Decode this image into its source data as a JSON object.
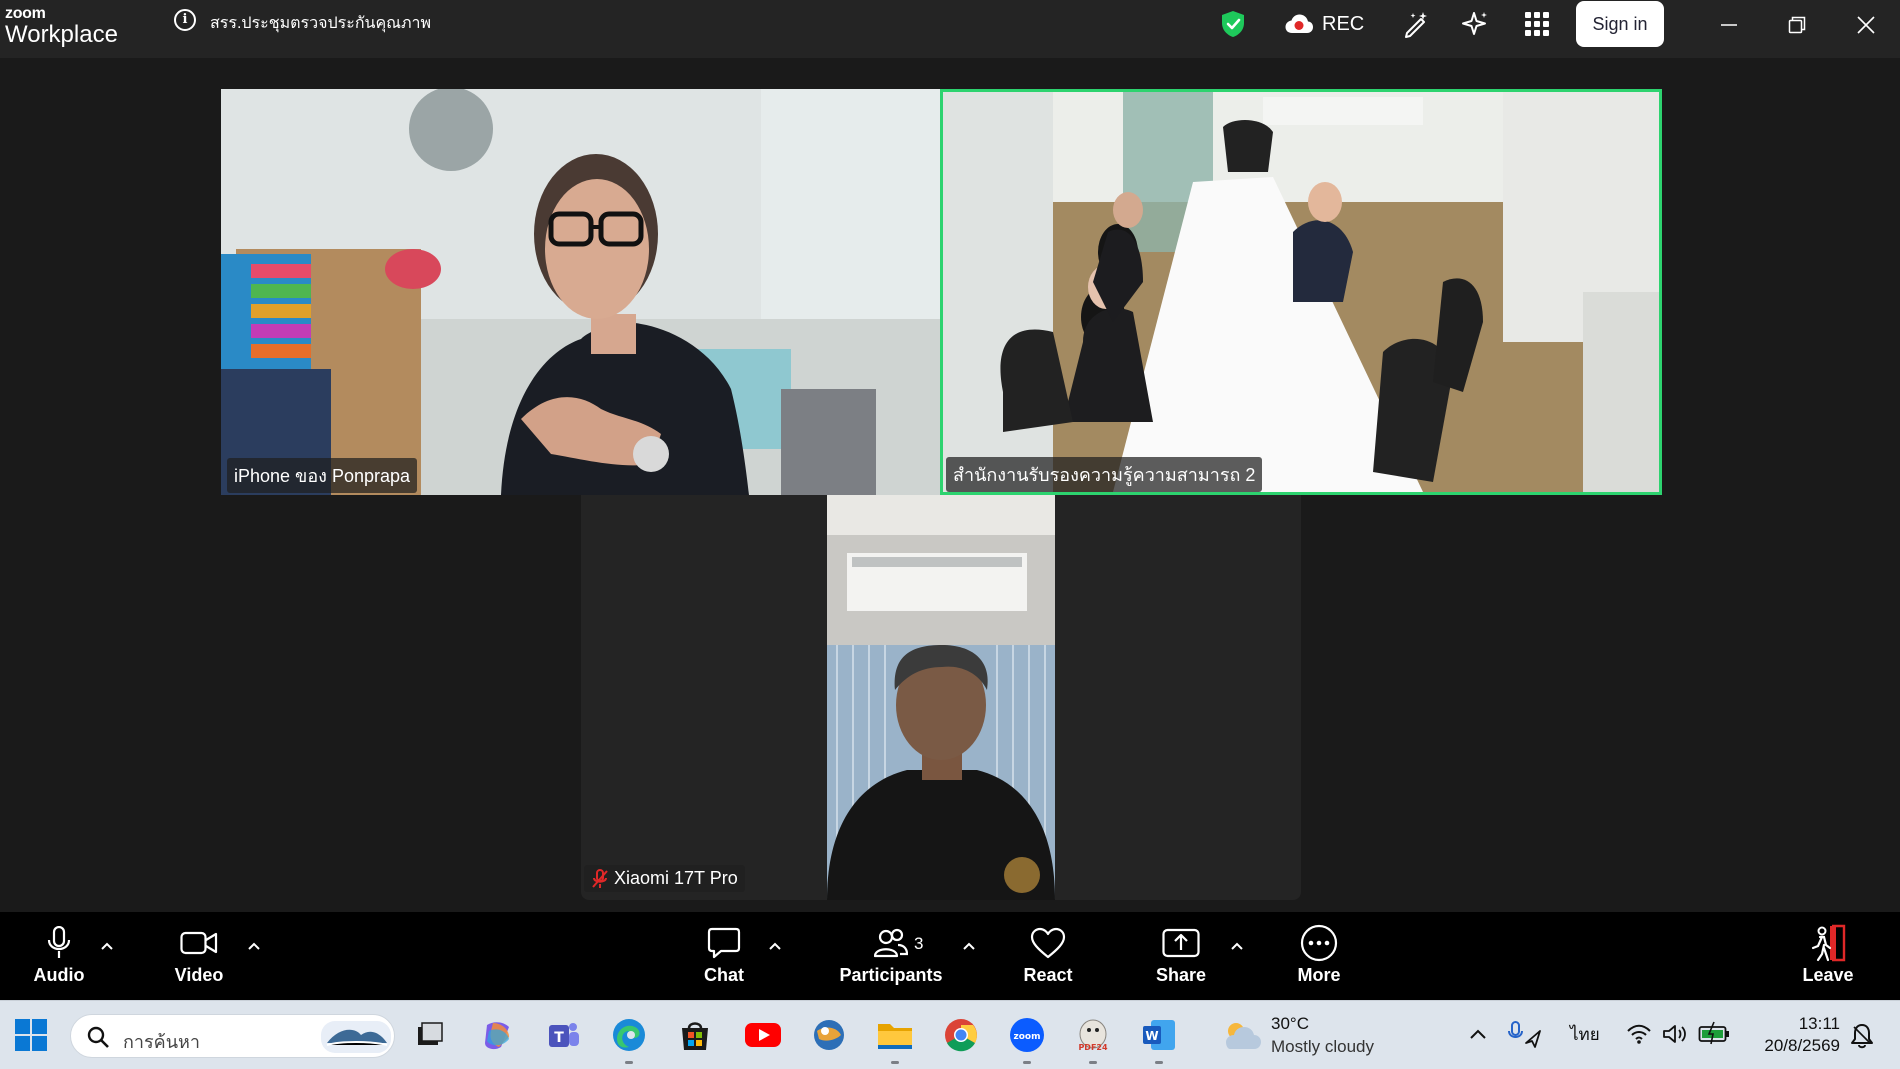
{
  "app": {
    "brand_top": "zoom",
    "brand_bottom": "Workplace",
    "meeting_title": "สรร.ประชุมตรวจประกันคุณภาพ"
  },
  "titlebar": {
    "rec_label": "REC",
    "signin_label": "Sign in",
    "icons": [
      "shield-check-icon",
      "cloud-record-icon",
      "magic-pen-icon",
      "ai-sparkle-icon",
      "apps-grid-icon"
    ]
  },
  "participants": [
    {
      "name": "iPhone ของ Ponprapa",
      "muted": false,
      "active_speaker": false
    },
    {
      "name": "สำนักงานรับรองความรู้ความสามารถ 2",
      "muted": false,
      "active_speaker": true
    },
    {
      "name": "Xiaomi 17T Pro",
      "muted": true,
      "active_speaker": false
    }
  ],
  "controls": {
    "audio": "Audio",
    "video": "Video",
    "chat": "Chat",
    "participants": "Participants",
    "participants_count": "3",
    "react": "React",
    "share": "Share",
    "more": "More",
    "leave": "Leave"
  },
  "taskbar": {
    "search_placeholder": "การค้นหา",
    "apps": [
      "start-icon",
      "task-view-icon",
      "copilot-icon",
      "teams-icon",
      "edge-icon",
      "store-icon",
      "youtube-icon",
      "app-icon",
      "file-explorer-icon",
      "chrome-icon",
      "zoom-icon",
      "pdf24-icon",
      "word-icon"
    ],
    "weather_temp": "30°C",
    "weather_desc": "Mostly cloudy",
    "language": "ไทย",
    "time": "13:11",
    "date": "20/8/2569"
  },
  "colors": {
    "active_speaker_border": "#2dd36f",
    "shield": "#1ec95b",
    "leave": "#e02828",
    "accent_blue": "#0b5cff"
  }
}
